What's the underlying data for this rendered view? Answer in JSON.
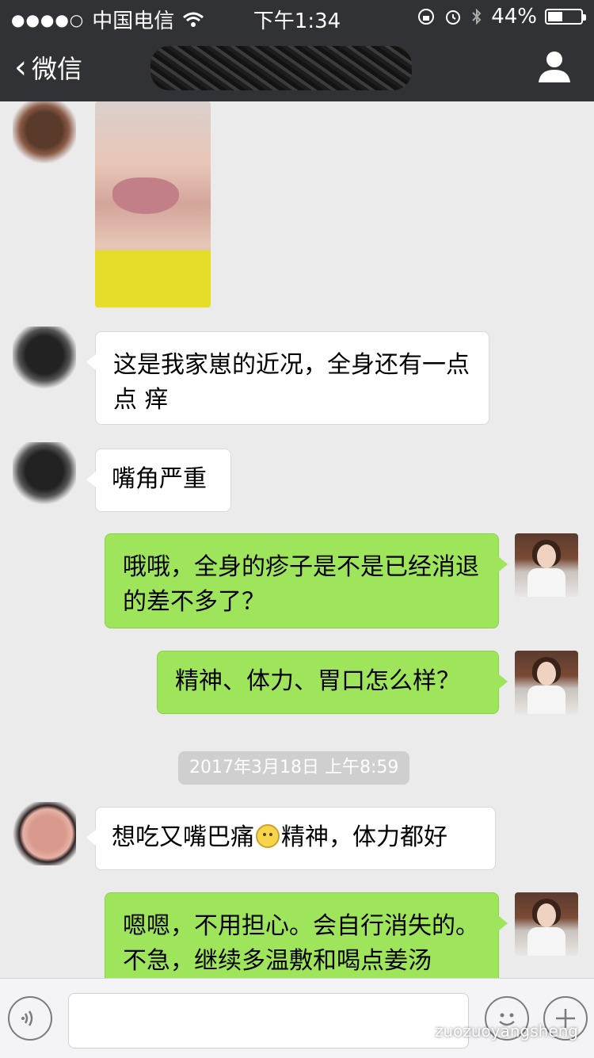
{
  "status_bar": {
    "signal": "●●●●○",
    "carrier": "中国电信",
    "time": "下午1:34",
    "battery": "44%",
    "battery_level": 0.44
  },
  "nav": {
    "back_label": "微信"
  },
  "messages": [
    {
      "id": "m1",
      "side": "received",
      "text": "这是我家崽的近况，全身还有一点点 痒"
    },
    {
      "id": "m2",
      "side": "received",
      "text": "嘴角严重"
    },
    {
      "id": "m3",
      "side": "sent",
      "text": "哦哦，全身的疹子是不是已经消退的差不多了？"
    },
    {
      "id": "m4",
      "side": "sent",
      "text": "精神、体力、胃口怎么样？"
    },
    {
      "id": "m5",
      "side": "received",
      "text_before_emoji": "想吃又嘴巴痛",
      "text_after_emoji": "精神，体力都好"
    },
    {
      "id": "m6",
      "side": "sent",
      "text": "嗯嗯，不用担心。会自行消失的。不急，继续多温敷和喝点姜汤"
    }
  ],
  "timestamp": "2017年3月18日 上午8:59",
  "input_bar": {
    "watermark": "zuozuoyangsheng"
  },
  "colors": {
    "nav_bg": "#313236",
    "chat_bg": "#ebebeb",
    "sent_bubble": "#9fe55c",
    "received_bubble": "#ffffff"
  }
}
